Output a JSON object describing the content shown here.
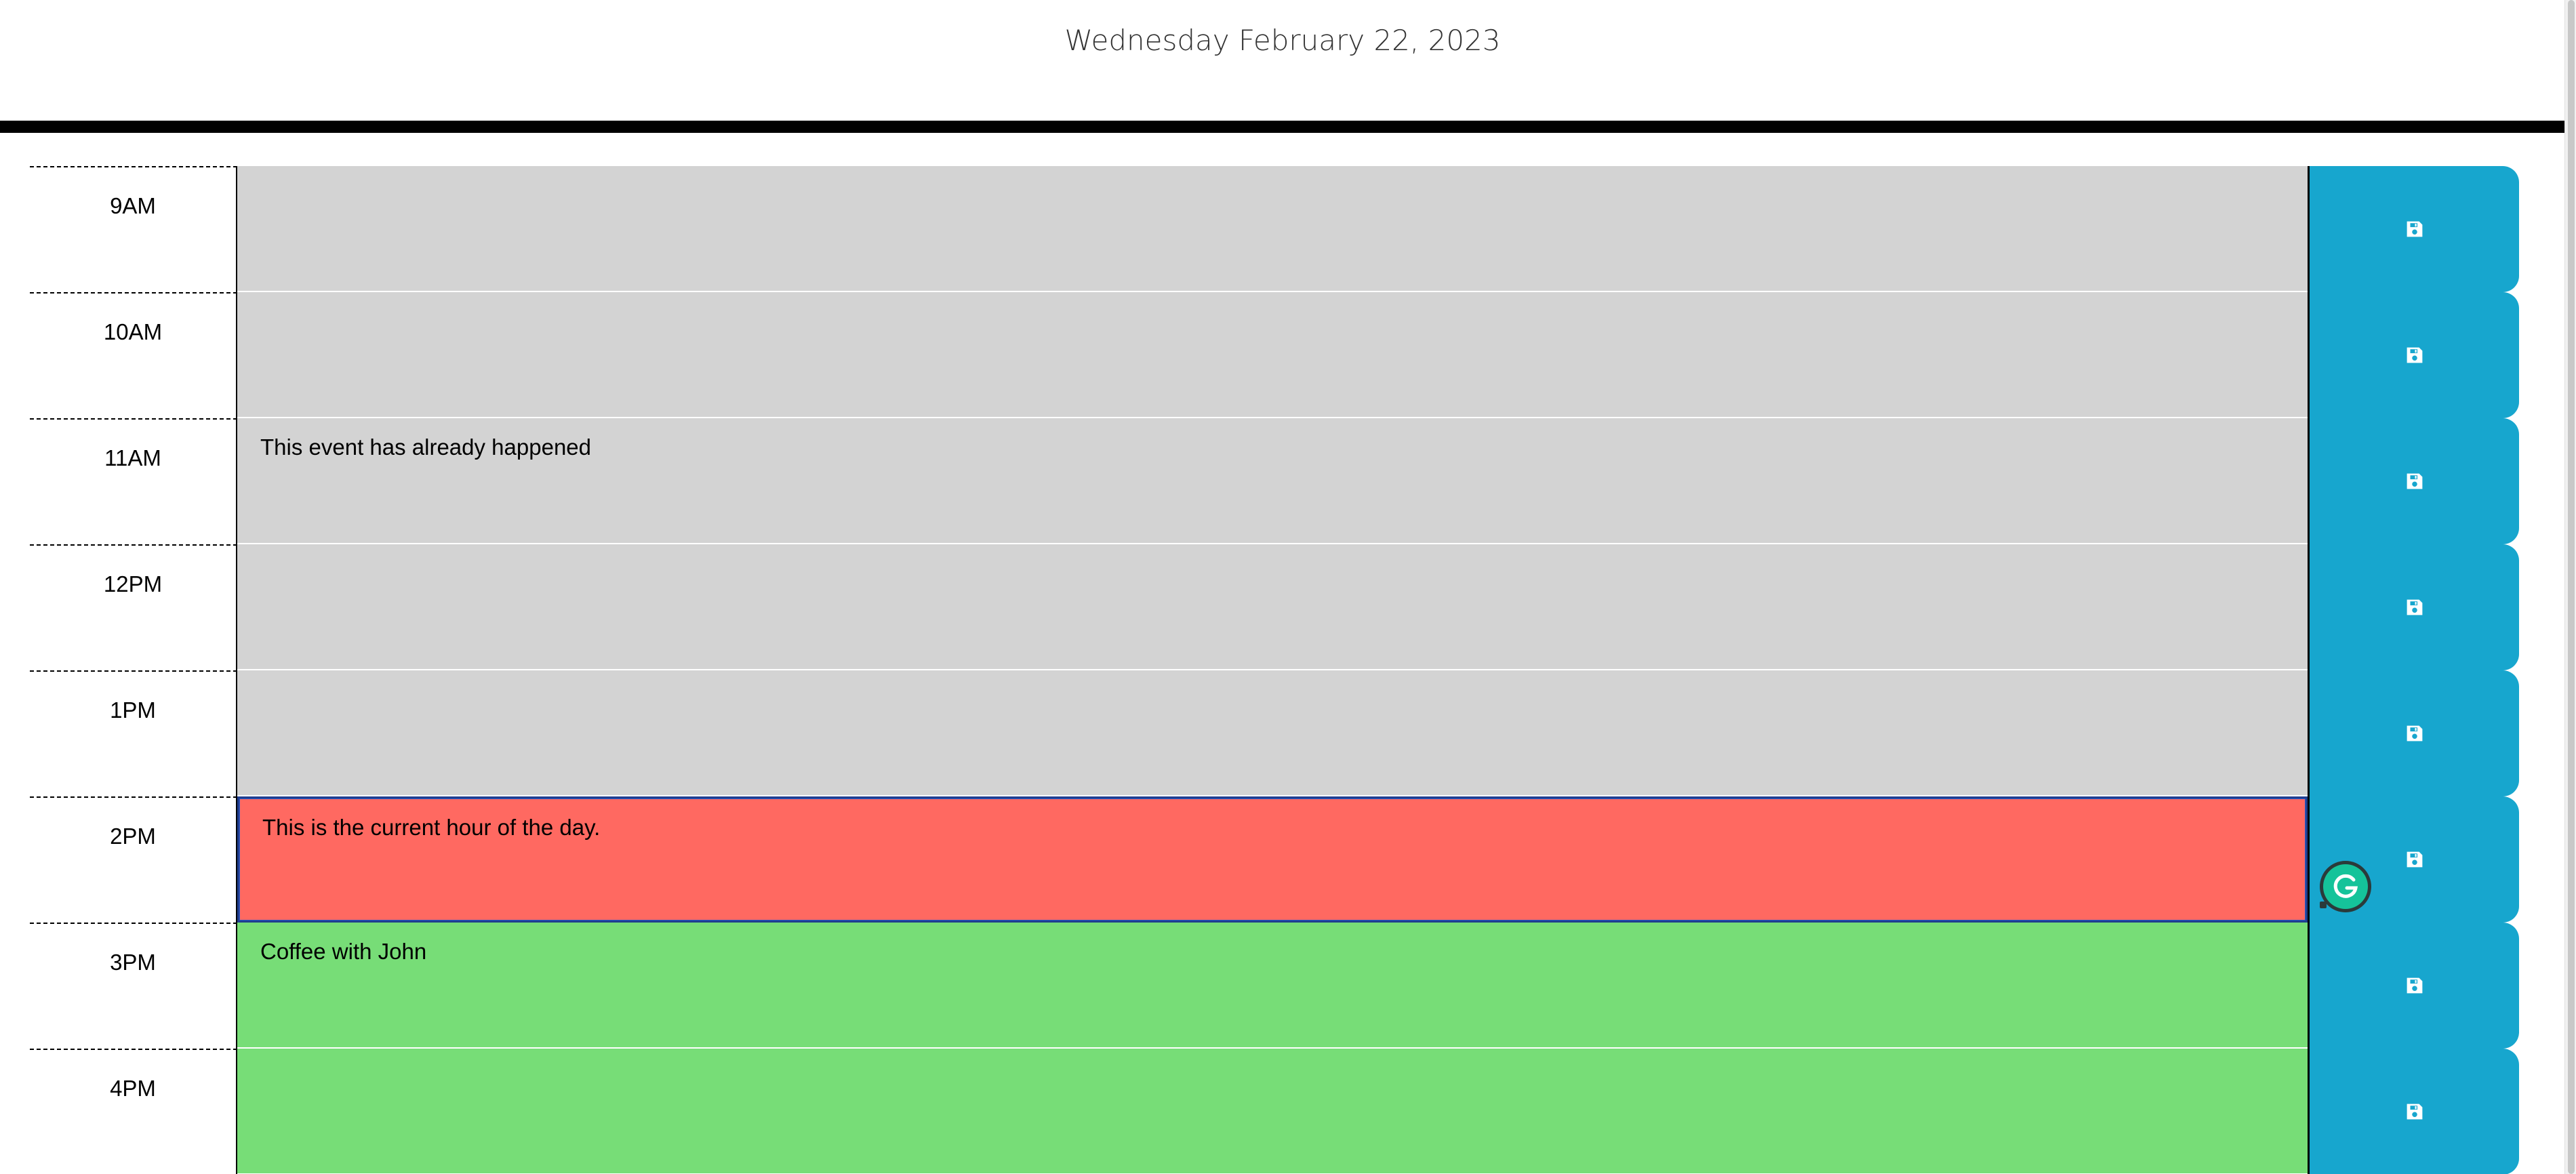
{
  "header": {
    "current_day": "Wednesday February 22, 2023"
  },
  "schedule": [
    {
      "hour": "9AM",
      "text": "",
      "state": "past"
    },
    {
      "hour": "10AM",
      "text": "",
      "state": "past"
    },
    {
      "hour": "11AM",
      "text": "This event has already happened",
      "state": "past"
    },
    {
      "hour": "12PM",
      "text": "",
      "state": "past"
    },
    {
      "hour": "1PM",
      "text": "",
      "state": "past"
    },
    {
      "hour": "2PM",
      "text": "This is the current hour of the day.",
      "state": "present"
    },
    {
      "hour": "3PM",
      "text": "Coffee with John",
      "state": "future"
    },
    {
      "hour": "4PM",
      "text": "",
      "state": "future"
    }
  ],
  "icons": {
    "save": "floppy-disk-icon",
    "grammarly": "grammarly-icon"
  },
  "colors": {
    "past": "#d3d3d3",
    "present": "#ff6961",
    "future": "#77dd77",
    "save_button": "#17a6ce",
    "grammarly": "#15c39a"
  }
}
